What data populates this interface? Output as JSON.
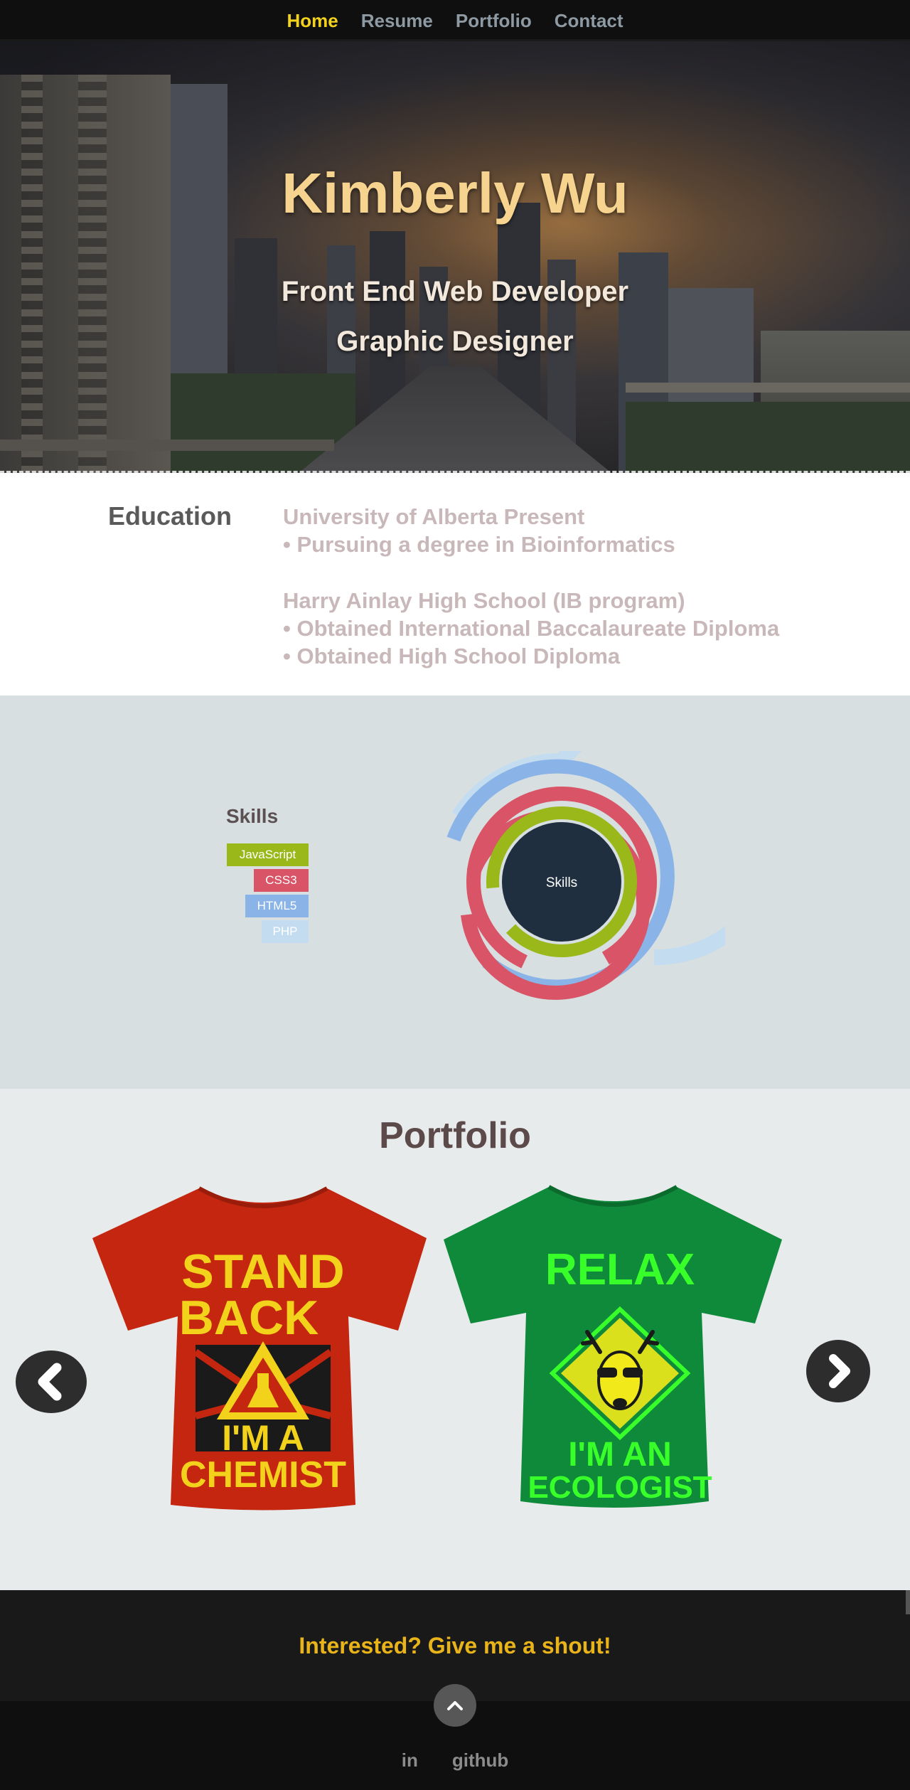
{
  "nav": {
    "items": [
      {
        "label": "Home",
        "active": true
      },
      {
        "label": "Resume",
        "active": false
      },
      {
        "label": "Portfolio",
        "active": false
      },
      {
        "label": "Contact",
        "active": false
      }
    ]
  },
  "hero": {
    "name": "Kimberly Wu",
    "role_1": "Front End Web Developer",
    "role_2": "Graphic Designer"
  },
  "education": {
    "heading": "Education",
    "entries": [
      {
        "school": "University of Alberta Present",
        "items": [
          "• Pursuing a degree in Bioinformatics"
        ]
      },
      {
        "school": "Harry Ainlay High School (IB program)",
        "items": [
          "• Obtained International Baccalaureate Diploma",
          "• Obtained High School Diploma"
        ]
      }
    ]
  },
  "skills": {
    "title": "Skills",
    "center_label": "Skills",
    "legend": [
      {
        "label": "JavaScript",
        "color": "#9ab81a"
      },
      {
        "label": "CSS3",
        "color": "#d85466"
      },
      {
        "label": "HTML5",
        "color": "#8ab4e8"
      },
      {
        "label": "PHP",
        "color": "#c4dcf0"
      }
    ]
  },
  "portfolio": {
    "title": "Portfolio",
    "items": [
      {
        "lines": [
          "STAND",
          "BACK",
          "I'M A",
          "CHEMIST"
        ],
        "shirt_color": "#c4260f",
        "text_color": "#f2d21b",
        "icon": "flask-warning-icon"
      },
      {
        "lines": [
          "RELAX",
          "I'M AN",
          "ECOLOGIST"
        ],
        "shirt_color": "#0f8a3a",
        "text_color": "#38ff2a",
        "icon": "deer-sunglasses-icon"
      }
    ]
  },
  "contact": {
    "cta": "Interested? Give me a shout!"
  },
  "footer": {
    "links": [
      "in",
      "github"
    ]
  }
}
